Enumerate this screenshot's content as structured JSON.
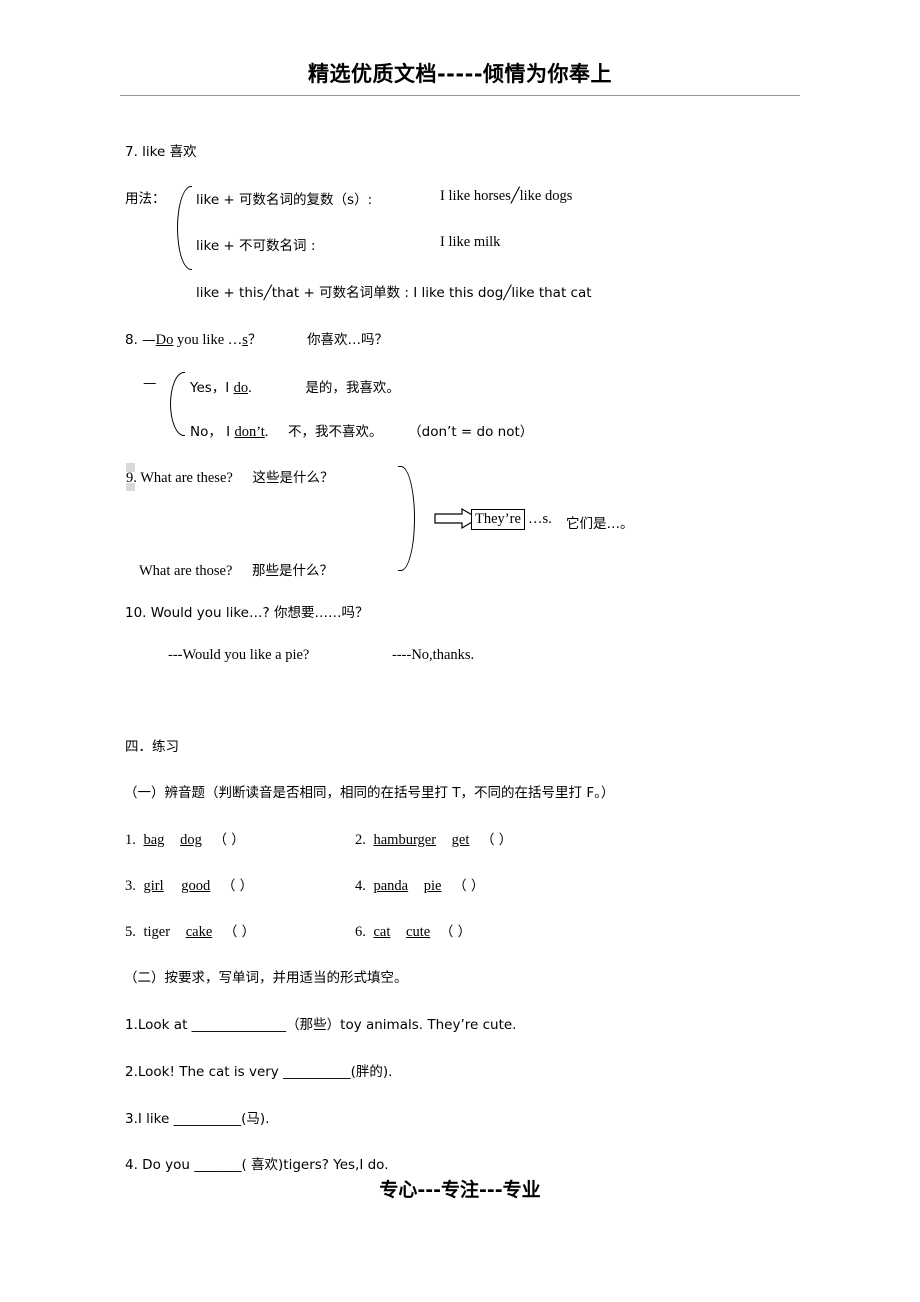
{
  "header": {
    "title": "精选优质文档-----倾情为你奉上"
  },
  "footer": {
    "title": "专心---专注---专业"
  },
  "content": {
    "item7": {
      "num_title": "7. like  喜欢",
      "usage_label": "用法：",
      "line1_left": "like +  可数名词的复数（s）:",
      "line1_right": "I like horses╱like dogs",
      "line2_left": "like +  不可数名词  :",
      "line2_right": "I like milk",
      "line3": "like + this╱that +  可数名词单数 : I like this dog╱like that cat"
    },
    "item8": {
      "question_pre": "8. —",
      "question_do": "Do",
      "question_mid": " you like …",
      "question_s": "s",
      "question_end": "？",
      "question_cn": "你喜欢…吗？",
      "dash": "—",
      "yes_en_pre": "Yes，I  ",
      "yes_en_u": "do",
      "yes_en_end": ".",
      "yes_cn": "是的，我喜欢。",
      "no_en_pre": "No，  I   ",
      "no_en_u": "don’t",
      "no_en_end": ".",
      "no_cn": "不，我不喜欢。",
      "no_note": "（don’t = do not）"
    },
    "item9": {
      "q1_en": "9. What are these?",
      "q1_cn": "这些是什么？",
      "q2_en": "What are those?",
      "q2_cn": "那些是什么？",
      "answer_box": "They’re",
      "answer_rest": "…s.",
      "answer_cn": "它们是…。"
    },
    "item10": {
      "title": "10. Would you like…?  你想要……吗？",
      "example_q": "---Would you like a pie?",
      "example_a": "----No,thanks."
    },
    "section4": {
      "title": "四．练习",
      "part1": {
        "title": "（一）辨音题（判断读音是否相同，相同的在括号里打 T，不同的在括号里打 F。）",
        "rows": [
          {
            "left_num": "1.",
            "left_w1": "bag",
            "left_w2": "dog",
            "left_paren": "（          ）",
            "right_num": "2.",
            "right_w1": "hamburger",
            "right_w2": "get",
            "right_paren": "（          ）"
          },
          {
            "left_num": "3.",
            "left_w1": "girl",
            "left_w2": "good",
            "left_paren": "（         ）",
            "right_num": "4.",
            "right_w1": "panda",
            "right_w2": "pie",
            "right_paren": "（          ）"
          },
          {
            "left_num": "5.",
            "left_w1": "tiger",
            "left_w2": "cake",
            "left_paren": "（        ）",
            "right_num": "6.",
            "right_w1": "cat",
            "right_w2": "cute",
            "right_paren": "（           ）"
          }
        ]
      },
      "part2": {
        "title": "（二）按要求，写单词，并用适当的形式填空。",
        "questions": [
          "1.Look at   ______________（那些）toy animals. They’re cute.",
          "2.Look! The cat is very __________(胖的).",
          "3.I like __________(马).",
          "4. Do you _______( 喜欢)tigers? Yes,I do."
        ]
      }
    }
  }
}
